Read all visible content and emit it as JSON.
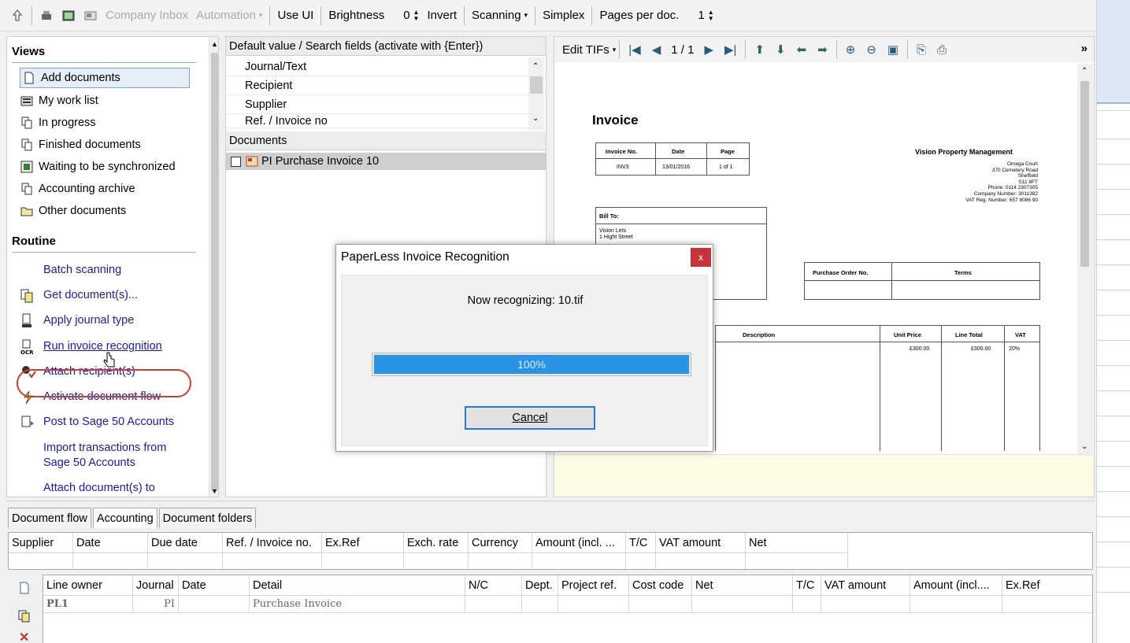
{
  "toolbar": {
    "company_inbox": "Company Inbox",
    "automation": "Automation",
    "use_ui": "Use UI",
    "brightness": "Brightness",
    "brightness_value": "0",
    "invert": "Invert",
    "scanning": "Scanning",
    "simplex": "Simplex",
    "pages_per_doc": "Pages per doc.",
    "pages_value": "1"
  },
  "views": {
    "title": "Views",
    "items": [
      {
        "label": "Add documents",
        "icon": "document-icon"
      },
      {
        "label": "My work list",
        "icon": "worklist-icon"
      },
      {
        "label": "In progress",
        "icon": "stack-icon"
      },
      {
        "label": "Finished documents",
        "icon": "stack-icon"
      },
      {
        "label": "Waiting to be synchronized",
        "icon": "sync-icon"
      },
      {
        "label": "Accounting archive",
        "icon": "stack-icon"
      },
      {
        "label": "Other documents",
        "icon": "folder-icon"
      }
    ]
  },
  "routine": {
    "title": "Routine",
    "items": [
      {
        "label": "Batch scanning"
      },
      {
        "label": "Get document(s)..."
      },
      {
        "label": "Apply journal type"
      },
      {
        "label": "Run invoice recognition"
      },
      {
        "label": "Attach recipient(s)"
      },
      {
        "label": "Activate document flow"
      },
      {
        "label": "Post to Sage 50 Accounts"
      },
      {
        "label": "Import transactions from Sage 50 Accounts"
      },
      {
        "label": "Attach document(s) to"
      }
    ]
  },
  "search": {
    "header": "Default value / Search fields (activate with {Enter})",
    "fields": [
      "Journal/Text",
      "Recipient",
      "Supplier",
      "Ref. / Invoice no"
    ]
  },
  "documents": {
    "header": "Documents",
    "items": [
      {
        "label": "PI Purchase Invoice  10"
      }
    ]
  },
  "viewer": {
    "edit_tifs": "Edit TIFs",
    "page_indicator": "1 / 1",
    "more": "»"
  },
  "invoice": {
    "title": "Invoice",
    "company": "Vision Property Management",
    "address": [
      "Omega Court",
      "370 Cemetery Road",
      "Sheffield",
      "S11 8FT",
      "Phone: 0114 2307305",
      "Company Number: 3011382",
      "VAT Reg. Number: 657 8086 90"
    ],
    "meta_headers": [
      "Invoice No.",
      "Date",
      "Page"
    ],
    "meta_values": [
      "INV3",
      "13/01/2016",
      "1 of 1"
    ],
    "bill_to_label": "Bill To:",
    "bill_to": [
      "Vision Lets",
      "1 Hight Street"
    ],
    "po_headers": [
      "Purchase Order No.",
      "Terms"
    ],
    "line_headers": [
      "Description",
      "Unit Price",
      "Line Total",
      "VAT"
    ],
    "line_values": [
      "£300.00",
      "£300.00",
      "20%"
    ]
  },
  "dialog": {
    "title": "PaperLess Invoice Recognition",
    "close": "x",
    "message": "Now recognizing: 10.tif",
    "progress": 100,
    "progress_label": "100%",
    "cancel": "Cancel"
  },
  "tabs": [
    "Document flow",
    "Accounting",
    "Document folders"
  ],
  "header_grid": {
    "columns": [
      "Supplier",
      "Date",
      "Due date",
      "Ref. / Invoice no.",
      "Ex.Ref",
      "Exch. rate",
      "Currency",
      "Amount (incl. ...",
      "T/C",
      "VAT amount",
      "Net"
    ]
  },
  "lines_grid": {
    "columns": [
      "Line owner",
      "Journal",
      "Date",
      "Detail",
      "N/C",
      "Dept.",
      "Project ref.",
      "Cost code",
      "Net",
      "T/C",
      "VAT amount",
      "Amount (incl....",
      "Ex.Ref"
    ],
    "rows": [
      {
        "line_owner": "PL1",
        "journal": "PI",
        "detail": "Purchase Invoice"
      }
    ]
  }
}
